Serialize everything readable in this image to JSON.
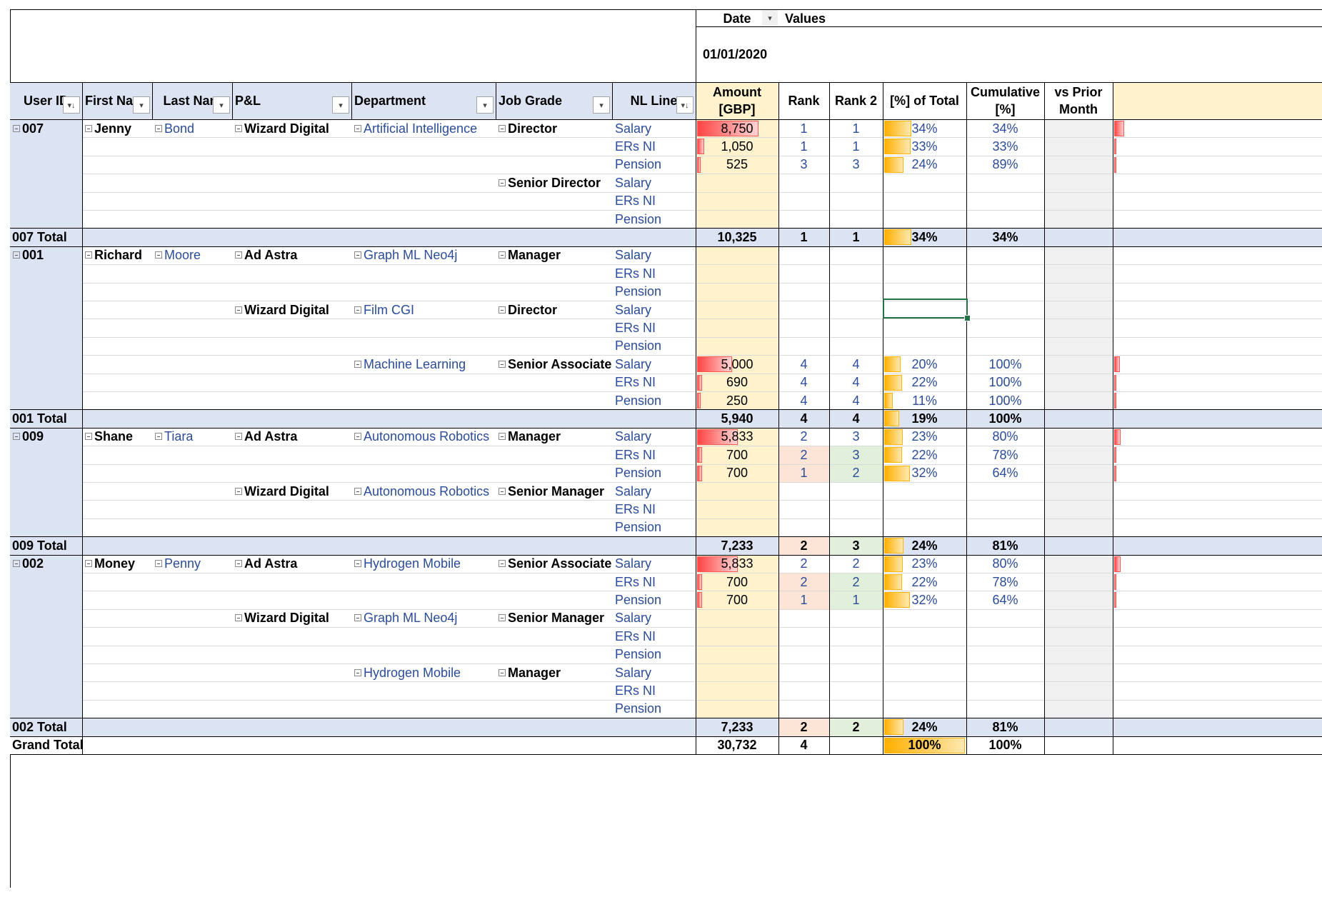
{
  "header": {
    "date_field": "Date",
    "values_label": "Values",
    "date_value": "01/01/2020",
    "columns": [
      "User ID",
      "First Na",
      "Last Nam",
      "P&L",
      "Department",
      "Job Grade",
      "NL Line",
      "Amount [GBP]",
      "Rank",
      "Rank 2",
      "[%] of Total",
      "Cumulative [%]",
      "vs Prior Month"
    ]
  },
  "colors": {
    "header_blue": "#dce3f2",
    "amount_fill": "#fff2cc",
    "rank_pink": "#fce4d6",
    "rank_green": "#e2efda",
    "text_blue": "#2b4c99",
    "bar_red": "#ff4444",
    "bar_orange": "#ffb000",
    "selection": "#217346"
  },
  "icons": {
    "collapse": "minus-box-icon",
    "filter": "filter-dropdown-icon",
    "sort": "sort-descending-icon"
  },
  "rows": [
    {
      "type": "data",
      "uid": "007",
      "first": "Jenny",
      "last": "Bond",
      "pl": "Wizard Digital",
      "dept": "Artificial Intelligence",
      "grade": "Director",
      "nl": "Salary",
      "amount": "8,750",
      "amount_num": 8750,
      "rank": "1",
      "rank2": "1",
      "pct": "34%",
      "pct_num": 34,
      "cum": "34%"
    },
    {
      "type": "data",
      "nl": "ERs NI",
      "amount": "1,050",
      "amount_num": 1050,
      "rank": "1",
      "rank2": "1",
      "pct": "33%",
      "pct_num": 33,
      "cum": "33%"
    },
    {
      "type": "data",
      "nl": "Pension",
      "amount": "525",
      "amount_num": 525,
      "rank": "3",
      "rank2": "3",
      "pct": "24%",
      "pct_num": 24,
      "cum": "89%"
    },
    {
      "type": "data",
      "grade": "Senior Director",
      "nl": "Salary"
    },
    {
      "type": "data",
      "nl": "ERs NI"
    },
    {
      "type": "data",
      "nl": "Pension"
    },
    {
      "type": "total",
      "label": "007 Total",
      "amount": "10,325",
      "rank": "1",
      "rank2": "1",
      "pct": "34%",
      "pct_num": 34,
      "cum": "34%"
    },
    {
      "type": "data",
      "uid": "001",
      "first": "Richard",
      "last": "Moore",
      "pl": "Ad Astra",
      "dept": "Graph ML Neo4j",
      "grade": "Manager",
      "nl": "Salary"
    },
    {
      "type": "data",
      "nl": "ERs NI"
    },
    {
      "type": "data",
      "nl": "Pension"
    },
    {
      "type": "data",
      "pl": "Wizard Digital",
      "dept": "Film CGI",
      "grade": "Director",
      "nl": "Salary"
    },
    {
      "type": "data",
      "nl": "ERs NI"
    },
    {
      "type": "data",
      "nl": "Pension"
    },
    {
      "type": "data",
      "dept": "Machine Learning",
      "grade": "Senior Associate",
      "nl": "Salary",
      "amount": "5,000",
      "amount_num": 5000,
      "rank": "4",
      "rank2": "4",
      "pct": "20%",
      "pct_num": 20,
      "cum": "100%"
    },
    {
      "type": "data",
      "nl": "ERs NI",
      "amount": "690",
      "amount_num": 690,
      "rank": "4",
      "rank2": "4",
      "pct": "22%",
      "pct_num": 22,
      "cum": "100%"
    },
    {
      "type": "data",
      "nl": "Pension",
      "amount": "250",
      "amount_num": 250,
      "rank": "4",
      "rank2": "4",
      "pct": "11%",
      "pct_num": 11,
      "cum": "100%"
    },
    {
      "type": "total",
      "label": "001 Total",
      "amount": "5,940",
      "rank": "4",
      "rank2": "4",
      "pct": "19%",
      "pct_num": 19,
      "cum": "100%"
    },
    {
      "type": "data",
      "uid": "009",
      "first": "Shane",
      "last": "Tiara",
      "pl": "Ad Astra",
      "dept": "Autonomous Robotics",
      "grade": "Manager",
      "nl": "Salary",
      "amount": "5,833",
      "amount_num": 5833,
      "rank": "2",
      "rank2": "3",
      "pct": "23%",
      "pct_num": 23,
      "cum": "80%"
    },
    {
      "type": "data",
      "nl": "ERs NI",
      "amount": "700",
      "amount_num": 700,
      "rank": "2",
      "rank2": "3",
      "pct": "22%",
      "pct_num": 22,
      "cum": "78%",
      "rank_pink": true,
      "rank2_green": true
    },
    {
      "type": "data",
      "nl": "Pension",
      "amount": "700",
      "amount_num": 700,
      "rank": "1",
      "rank2": "2",
      "pct": "32%",
      "pct_num": 32,
      "cum": "64%",
      "rank_pink": true,
      "rank2_green": true
    },
    {
      "type": "data",
      "pl": "Wizard Digital",
      "dept": "Autonomous Robotics",
      "grade": "Senior Manager",
      "nl": "Salary"
    },
    {
      "type": "data",
      "nl": "ERs NI"
    },
    {
      "type": "data",
      "nl": "Pension"
    },
    {
      "type": "total",
      "label": "009 Total",
      "amount": "7,233",
      "rank": "2",
      "rank2": "3",
      "pct": "24%",
      "pct_num": 24,
      "cum": "81%",
      "rank_pink": true,
      "rank2_green": true
    },
    {
      "type": "data",
      "uid": "002",
      "first": "Money",
      "last": "Penny",
      "pl": "Ad Astra",
      "dept": "Hydrogen Mobile",
      "grade": "Senior Associate",
      "nl": "Salary",
      "amount": "5,833",
      "amount_num": 5833,
      "rank": "2",
      "rank2": "2",
      "pct": "23%",
      "pct_num": 23,
      "cum": "80%"
    },
    {
      "type": "data",
      "nl": "ERs NI",
      "amount": "700",
      "amount_num": 700,
      "rank": "2",
      "rank2": "2",
      "pct": "22%",
      "pct_num": 22,
      "cum": "78%",
      "rank_pink": true,
      "rank2_green": true
    },
    {
      "type": "data",
      "nl": "Pension",
      "amount": "700",
      "amount_num": 700,
      "rank": "1",
      "rank2": "1",
      "pct": "32%",
      "pct_num": 32,
      "cum": "64%",
      "rank_pink": true,
      "rank2_green": true
    },
    {
      "type": "data",
      "pl": "Wizard Digital",
      "dept": "Graph ML Neo4j",
      "grade": "Senior Manager",
      "nl": "Salary"
    },
    {
      "type": "data",
      "nl": "ERs NI"
    },
    {
      "type": "data",
      "nl": "Pension"
    },
    {
      "type": "data",
      "dept": "Hydrogen Mobile",
      "grade": "Manager",
      "nl": "Salary"
    },
    {
      "type": "data",
      "nl": "ERs NI"
    },
    {
      "type": "data",
      "nl": "Pension"
    },
    {
      "type": "total",
      "label": "002 Total",
      "amount": "7,233",
      "rank": "2",
      "rank2": "2",
      "pct": "24%",
      "pct_num": 24,
      "cum": "81%",
      "rank_pink": true,
      "rank2_green": true
    },
    {
      "type": "grand",
      "label": "Grand Total",
      "amount": "30,732",
      "rank": "4",
      "rank2": "",
      "pct": "100%",
      "pct_num": 100,
      "cum": "100%"
    }
  ]
}
